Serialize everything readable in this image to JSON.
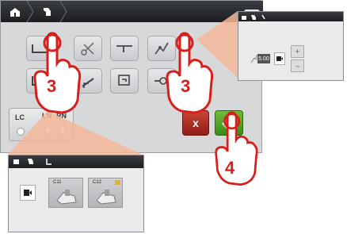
{
  "window": {
    "breadcrumb": [
      "home-icon",
      "presser-foot-icon"
    ],
    "close_label": "x"
  },
  "controls": {
    "options_panel": {
      "label_lc": "LC",
      "label_ln": "LN",
      "label_rn": "RN"
    },
    "cancel_label": "x"
  },
  "callouts": {
    "step_left": "3",
    "step_right": "3",
    "step_ok": "4"
  },
  "inset_right": {
    "value_display": "5.00",
    "plus_label": "+",
    "minus_label": "–"
  },
  "inset_bottom": {
    "tiles": [
      {
        "label": "C11"
      },
      {
        "label": "C12"
      }
    ]
  },
  "colors": {
    "callout_red": "#d6201b",
    "ok_green": "#4da328",
    "cancel_red": "#b0342a",
    "highlight_peach": "#f4b89a",
    "topbar": "#25282c"
  }
}
